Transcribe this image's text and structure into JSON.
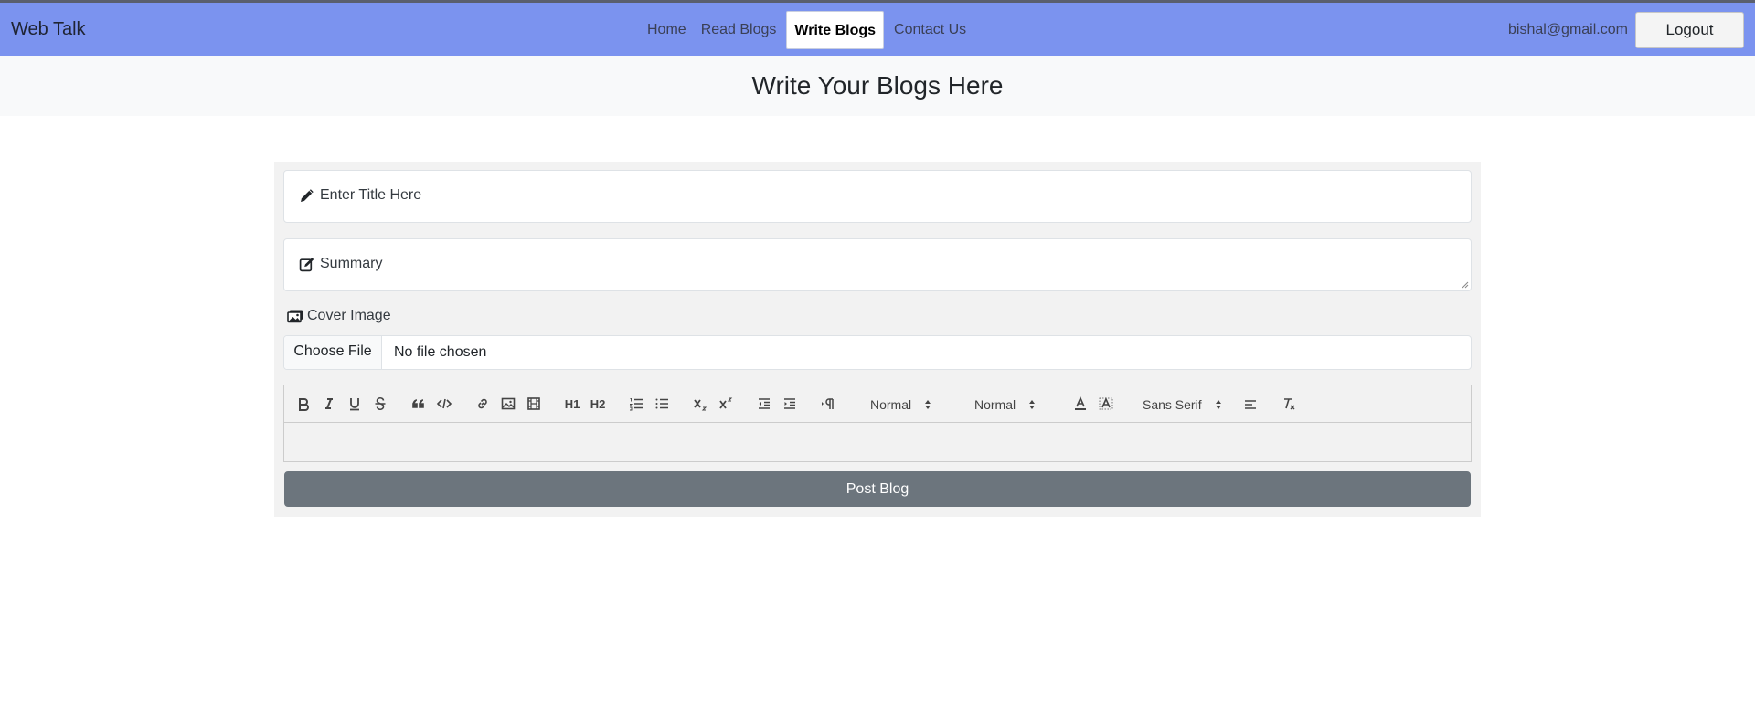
{
  "navbar": {
    "brand": "Web Talk",
    "links": [
      {
        "label": "Home"
      },
      {
        "label": "Read Blogs"
      },
      {
        "label": "Write Blogs"
      },
      {
        "label": "Contact Us"
      }
    ],
    "active_link": "Write Blogs",
    "user_email": "bishal@gmail.com",
    "logout_label": "Logout",
    "background_color": "#7b93ef"
  },
  "page": {
    "title": "Write Your Blogs Here"
  },
  "form": {
    "title_placeholder": "Enter Title Here",
    "summary_placeholder": "Summary",
    "cover_image_label": "Cover Image",
    "file_button_label": "Choose File",
    "file_status": "No file chosen",
    "editor": {
      "header_picker": "Normal",
      "size_picker": "Normal",
      "font_picker": "Sans Serif",
      "toolbar_icons": [
        "bold-icon",
        "italic-icon",
        "underline-icon",
        "strike-icon",
        "blockquote-icon",
        "code-block-icon",
        "link-icon",
        "image-icon",
        "video-icon",
        "header-1-icon",
        "header-2-icon",
        "ordered-list-icon",
        "bullet-list-icon",
        "subscript-icon",
        "superscript-icon",
        "outdent-icon",
        "indent-icon",
        "text-direction-icon",
        "text-color-icon",
        "background-color-icon",
        "align-icon",
        "clean-format-icon"
      ],
      "h1_label": "H1",
      "h2_label": "H2"
    },
    "submit_label": "Post Blog",
    "submit_color": "#6c757d"
  }
}
